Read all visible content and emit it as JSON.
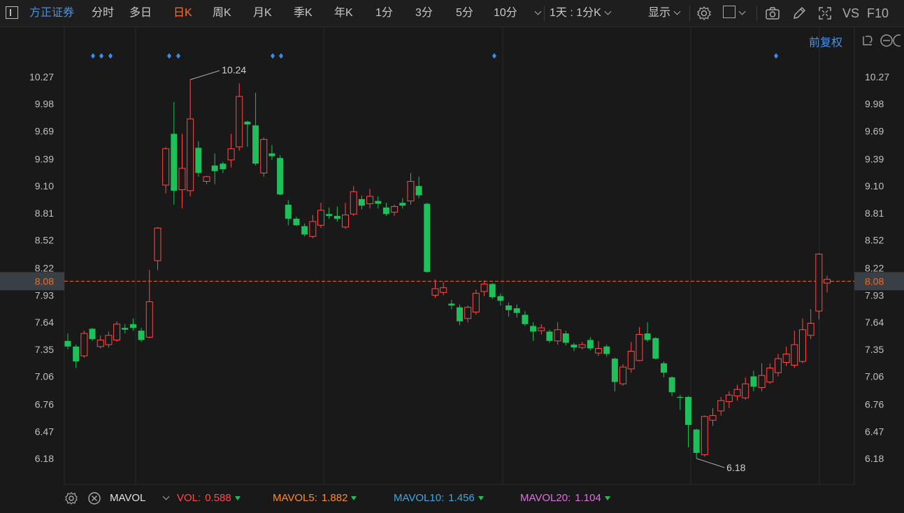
{
  "toolbar": {
    "brand": "方正证券",
    "periods": [
      {
        "label": "分时",
        "active": false
      },
      {
        "label": "多日",
        "active": false
      },
      {
        "label": "日K",
        "active": true
      },
      {
        "label": "周K",
        "active": false
      },
      {
        "label": "月K",
        "active": false
      },
      {
        "label": "季K",
        "active": false
      },
      {
        "label": "年K",
        "active": false
      },
      {
        "label": "1分",
        "active": false
      },
      {
        "label": "3分",
        "active": false
      },
      {
        "label": "5分",
        "active": false
      },
      {
        "label": "10分",
        "active": false
      }
    ],
    "interval": "1天 : 1分K",
    "display_label": "显示",
    "vs_label": "VS",
    "f10_label": "F10"
  },
  "chart_header": {
    "adjust_label": "前复权"
  },
  "chart_data": {
    "type": "candlestick",
    "y_ticks": [
      "10.27",
      "9.98",
      "9.69",
      "9.39",
      "9.10",
      "8.81",
      "8.52",
      "8.22",
      "7.93",
      "7.64",
      "7.35",
      "7.06",
      "6.76",
      "6.47",
      "6.18"
    ],
    "ylim": [
      6.18,
      10.27
    ],
    "current_price": "8.08",
    "high_label": "10.24",
    "low_label": "6.18",
    "colors": {
      "up": "#ff4a4a",
      "down": "#1fbf5a",
      "current": "#e8702a"
    },
    "candles": [
      [
        7.44,
        7.38,
        7.52,
        7.35
      ],
      [
        7.38,
        7.22,
        7.4,
        7.15
      ],
      [
        7.28,
        7.52,
        7.55,
        7.26
      ],
      [
        7.57,
        7.46,
        7.58,
        7.44
      ],
      [
        7.38,
        7.45,
        7.5,
        7.36
      ],
      [
        7.4,
        7.5,
        7.54,
        7.37
      ],
      [
        7.45,
        7.62,
        7.65,
        7.43
      ],
      [
        7.58,
        7.56,
        7.62,
        7.52
      ],
      [
        7.62,
        7.58,
        7.68,
        7.55
      ],
      [
        7.55,
        7.45,
        7.58,
        7.43
      ],
      [
        7.48,
        7.86,
        8.2,
        7.47
      ],
      [
        8.3,
        8.65,
        8.66,
        8.2
      ],
      [
        9.11,
        9.5,
        9.52,
        9.02
      ],
      [
        9.66,
        9.05,
        10.0,
        8.9
      ],
      [
        9.06,
        9.29,
        9.66,
        8.86
      ],
      [
        9.05,
        9.82,
        10.24,
        8.99
      ],
      [
        9.51,
        9.24,
        9.58,
        9.2
      ],
      [
        9.15,
        9.2,
        9.21,
        9.12
      ],
      [
        9.32,
        9.26,
        9.45,
        9.12
      ],
      [
        9.34,
        9.28,
        9.36,
        9.24
      ],
      [
        9.38,
        9.5,
        9.66,
        9.3
      ],
      [
        9.52,
        10.06,
        10.2,
        9.48
      ],
      [
        9.79,
        9.76,
        9.8,
        9.52
      ],
      [
        9.75,
        9.34,
        10.1,
        9.32
      ],
      [
        9.24,
        9.6,
        9.62,
        9.2
      ],
      [
        9.45,
        9.42,
        9.54,
        9.38
      ],
      [
        9.4,
        9.01,
        9.43,
        9.0
      ],
      [
        8.9,
        8.75,
        8.95,
        8.68
      ],
      [
        8.75,
        8.68,
        8.77,
        8.67
      ],
      [
        8.67,
        8.58,
        8.7,
        8.56
      ],
      [
        8.56,
        8.72,
        8.79,
        8.54
      ],
      [
        8.68,
        8.84,
        8.92,
        8.65
      ],
      [
        8.8,
        8.78,
        8.87,
        8.75
      ],
      [
        8.78,
        8.75,
        8.88,
        8.72
      ],
      [
        8.66,
        8.79,
        8.92,
        8.64
      ],
      [
        8.8,
        9.04,
        9.1,
        8.78
      ],
      [
        8.96,
        8.89,
        9.0,
        8.85
      ],
      [
        8.91,
        8.99,
        9.07,
        8.86
      ],
      [
        8.94,
        8.91,
        8.99,
        8.86
      ],
      [
        8.87,
        8.8,
        8.92,
        8.78
      ],
      [
        8.82,
        8.88,
        8.9,
        8.78
      ],
      [
        8.92,
        8.89,
        8.97,
        8.86
      ],
      [
        8.94,
        9.15,
        9.24,
        8.9
      ],
      [
        9.1,
        9.0,
        9.2,
        8.97
      ],
      [
        8.91,
        8.18,
        8.92,
        8.17
      ],
      [
        7.93,
        8.0,
        8.1,
        7.9
      ],
      [
        7.96,
        8.01,
        8.07,
        7.93
      ],
      [
        7.84,
        7.82,
        7.88,
        7.78
      ],
      [
        7.8,
        7.65,
        7.83,
        7.61
      ],
      [
        7.68,
        7.8,
        7.82,
        7.64
      ],
      [
        7.75,
        7.95,
        7.99,
        7.72
      ],
      [
        7.97,
        8.05,
        8.09,
        7.92
      ],
      [
        8.05,
        7.91,
        8.06,
        7.89
      ],
      [
        7.92,
        7.87,
        7.95,
        7.82
      ],
      [
        7.82,
        7.77,
        7.85,
        7.7
      ],
      [
        7.79,
        7.74,
        7.83,
        7.69
      ],
      [
        7.72,
        7.62,
        7.76,
        7.6
      ],
      [
        7.6,
        7.54,
        7.64,
        7.44
      ],
      [
        7.55,
        7.58,
        7.62,
        7.51
      ],
      [
        7.54,
        7.44,
        7.56,
        7.42
      ],
      [
        7.44,
        7.56,
        7.64,
        7.4
      ],
      [
        7.52,
        7.42,
        7.55,
        7.39
      ],
      [
        7.4,
        7.37,
        7.42,
        7.33
      ],
      [
        7.37,
        7.4,
        7.43,
        7.35
      ],
      [
        7.45,
        7.36,
        7.48,
        7.34
      ],
      [
        7.31,
        7.36,
        7.44,
        7.28
      ],
      [
        7.38,
        7.3,
        7.4,
        7.27
      ],
      [
        7.25,
        7.0,
        7.26,
        6.9
      ],
      [
        6.98,
        7.16,
        7.19,
        6.96
      ],
      [
        7.14,
        7.33,
        7.43,
        7.1
      ],
      [
        7.23,
        7.51,
        7.59,
        7.22
      ],
      [
        7.52,
        7.45,
        7.64,
        7.43
      ],
      [
        7.47,
        7.25,
        7.48,
        7.24
      ],
      [
        7.2,
        7.1,
        7.22,
        7.05
      ],
      [
        7.05,
        6.89,
        7.06,
        6.85
      ],
      [
        6.84,
        6.83,
        6.86,
        6.7
      ],
      [
        6.84,
        6.54,
        6.85,
        6.3
      ],
      [
        6.49,
        6.24,
        6.5,
        6.18
      ],
      [
        6.22,
        6.63,
        6.64,
        6.2
      ],
      [
        6.59,
        6.64,
        6.72,
        6.53
      ],
      [
        6.69,
        6.8,
        6.84,
        6.64
      ],
      [
        6.79,
        6.86,
        6.9,
        6.72
      ],
      [
        6.85,
        6.92,
        6.97,
        6.8
      ],
      [
        6.83,
        6.98,
        7.05,
        6.81
      ],
      [
        7.06,
        6.95,
        7.12,
        6.9
      ],
      [
        6.94,
        7.07,
        7.2,
        6.9
      ],
      [
        7.0,
        7.15,
        7.2,
        6.98
      ],
      [
        7.1,
        7.25,
        7.3,
        7.06
      ],
      [
        7.21,
        7.3,
        7.38,
        7.17
      ],
      [
        7.18,
        7.4,
        7.55,
        7.15
      ],
      [
        7.22,
        7.56,
        7.68,
        7.2
      ],
      [
        7.5,
        7.63,
        7.78,
        7.46
      ],
      [
        7.76,
        8.37,
        8.38,
        7.67
      ],
      [
        8.06,
        8.1,
        8.14,
        7.96
      ]
    ],
    "ticks_positions_note": "",
    "footer_indicator": {
      "name": "MAVOL",
      "items": [
        {
          "label": "VOL:",
          "value": "0.588",
          "color": "#ff4a4a"
        },
        {
          "label": "MAVOL5:",
          "value": "1.882",
          "color": "#ff8a2c"
        },
        {
          "label": "MAVOL10:",
          "value": "1.456",
          "color": "#3aa7e8"
        },
        {
          "label": "MAVOL20:",
          "value": "1.104",
          "color": "#e070e0"
        }
      ]
    }
  }
}
